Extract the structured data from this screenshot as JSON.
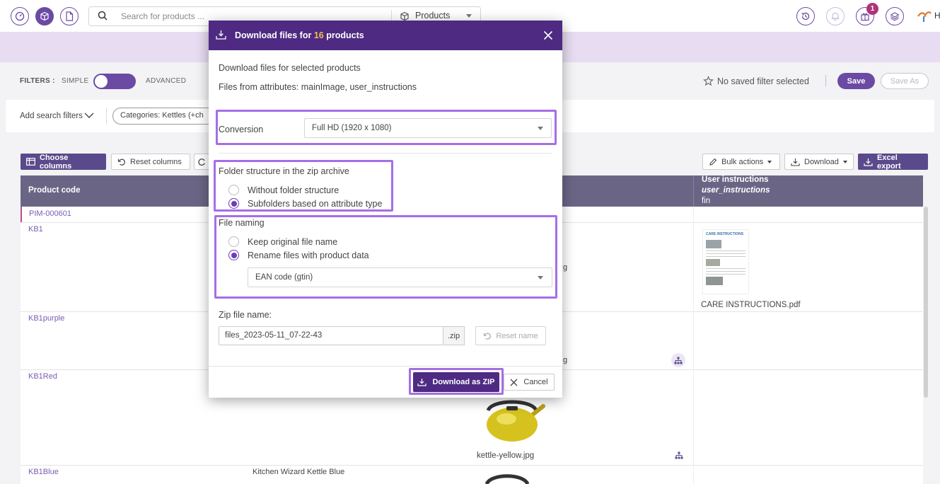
{
  "topbar": {
    "search_placeholder": "Search for products ...",
    "search_scope": "Products",
    "notification_count": "1",
    "user_initial": "H"
  },
  "filters": {
    "label": "FILTERS :",
    "mode_simple": "SIMPLE",
    "mode_advanced": "ADVANCED",
    "saved_filter_text": "No saved filter selected",
    "save_label": "Save",
    "save_as_label": "Save As",
    "add_search_filters": "Add search filters",
    "chip_label": "Categories:  Kettles (+ch"
  },
  "toolbar": {
    "choose_columns": "Choose columns",
    "reset_columns": "Reset columns",
    "bulk_actions": "Bulk actions",
    "download": "Download",
    "excel_export": "Excel export"
  },
  "table": {
    "header_product_code": "Product code",
    "header_user_instructions": "User instructions",
    "header_user_instructions_attr": "user_instructions",
    "header_user_instructions_lang": "fin",
    "rows": [
      {
        "code": "PIM-000601",
        "name": ""
      },
      {
        "code": "KB1",
        "name": ""
      },
      {
        "code": "KB1purple",
        "name": ""
      },
      {
        "code": "KB1Red",
        "name": ""
      },
      {
        "code": "KB1Blue",
        "name": "Kitchen Wizard Kettle Blue"
      }
    ],
    "pdf_caption": "CARE INSTRUCTIONS.pdf",
    "pdf_thumb_title": "CARE INSTRUCTIONS",
    "kettle_caption": "kettle-yellow.jpg",
    "partial_ext_1": "g",
    "partial_ext_2": "g"
  },
  "modal": {
    "title_prefix": "Download files for",
    "title_count": "16",
    "title_suffix": "products",
    "intro": "Download files for selected products",
    "attributes_line": "Files from attributes: mainImage, user_instructions",
    "conversion_label": "Conversion",
    "conversion_value": "Full HD (1920 x 1080)",
    "folder_label": "Folder structure in the zip archive",
    "folder_options": [
      "Without folder structure",
      "Subfolders based on attribute type"
    ],
    "naming_label": "File naming",
    "naming_options": [
      "Keep original file name",
      "Rename files with product data"
    ],
    "naming_select_value": "EAN code (gtin)",
    "zip_label": "Zip file name:",
    "zip_value": "files_2023-05-11_07-22-43",
    "zip_suffix": ".zip",
    "reset_name": "Reset name",
    "download_zip": "Download as ZIP",
    "cancel": "Cancel"
  },
  "colors": {
    "brand_purple": "#4e2a82",
    "accent_purple": "#6b4aa3",
    "highlight": "#a66ee6",
    "table_header": "#6b6585"
  }
}
